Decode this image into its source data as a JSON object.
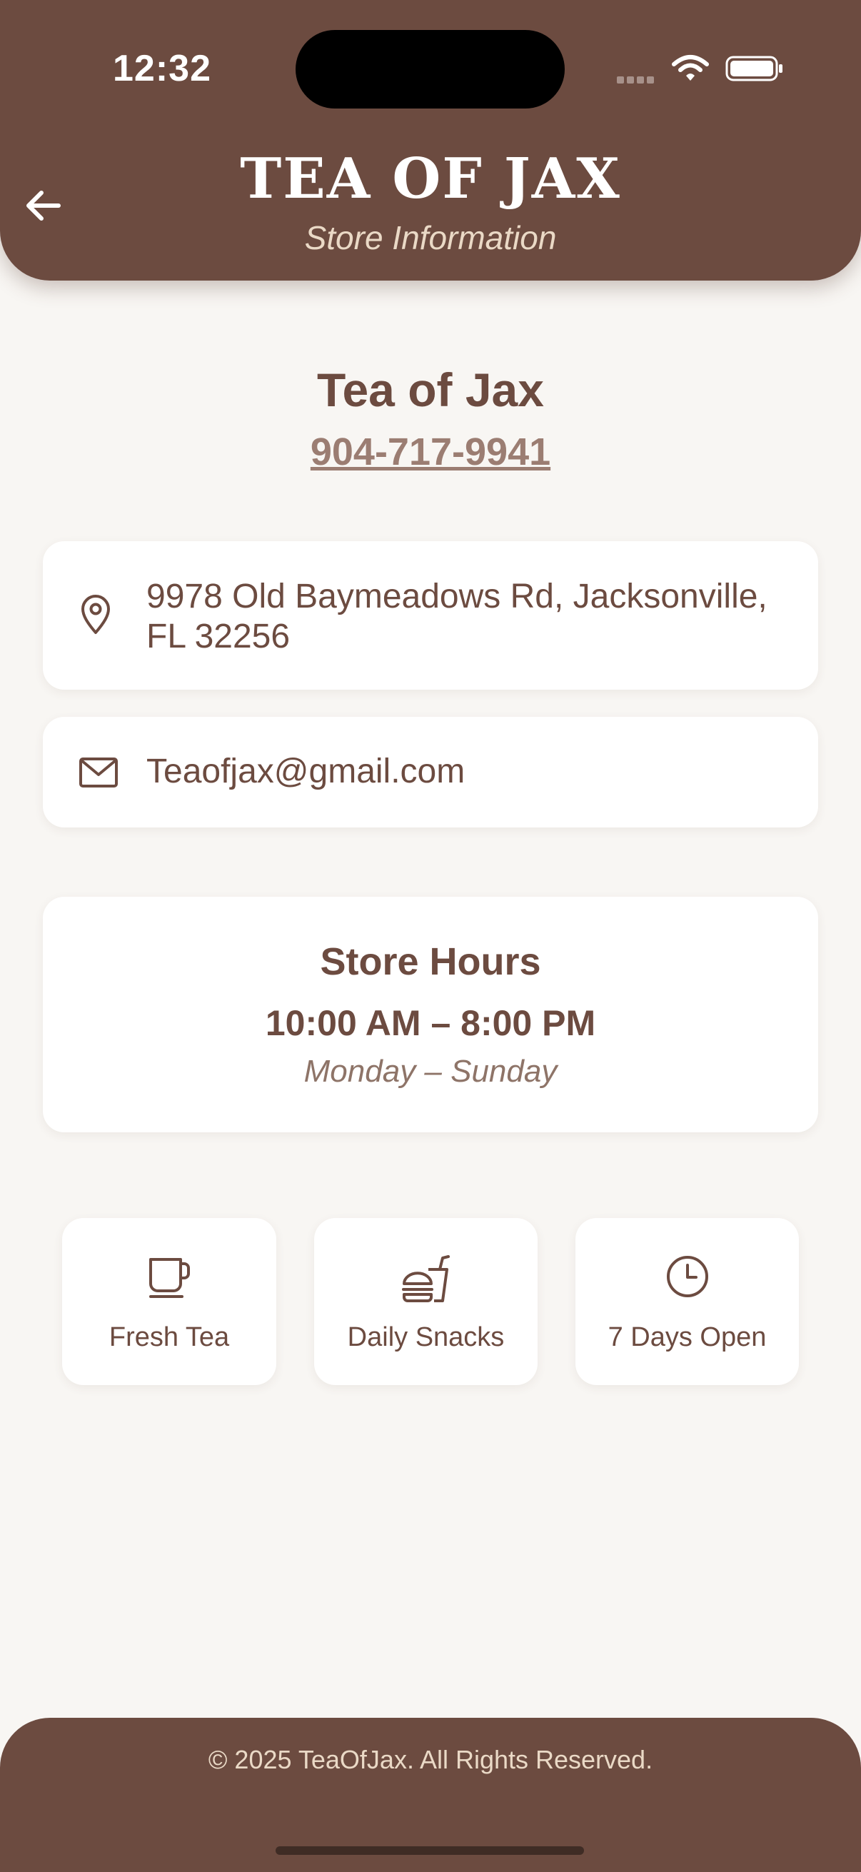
{
  "status_bar": {
    "time": "12:32"
  },
  "header": {
    "brand": "TEA OF JAX",
    "subtitle": "Store Information",
    "back_icon": "arrow-left-icon"
  },
  "store": {
    "name": "Tea of Jax",
    "phone": "904-717-9941"
  },
  "contact": {
    "address": "9978 Old Baymeadows Rd, Jacksonville, FL 32256",
    "address_icon": "map-pin-icon",
    "email": "Teaofjax@gmail.com",
    "email_icon": "mail-icon"
  },
  "hours": {
    "title": "Store Hours",
    "time": "10:00 AM – 8:00 PM",
    "days": "Monday – Sunday"
  },
  "features": [
    {
      "label": "Fresh Tea",
      "icon": "cup-icon"
    },
    {
      "label": "Daily Snacks",
      "icon": "fast-food-icon"
    },
    {
      "label": "7 Days Open",
      "icon": "clock-icon"
    }
  ],
  "footer": {
    "copyright": "© 2025 TeaOfJax. All Rights Reserved."
  },
  "colors": {
    "primary": "#6c4b40",
    "background": "#f8f6f3",
    "accent_light": "#ead9c6",
    "link": "#9b7d72"
  }
}
